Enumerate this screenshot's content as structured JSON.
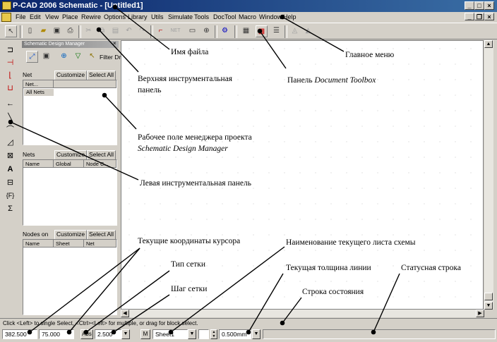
{
  "window": {
    "title": "P-CAD 2006 Schematic - [Untitled1]"
  },
  "menu": [
    "File",
    "Edit",
    "View",
    "Place",
    "Rewire",
    "Options",
    "Library",
    "Utils",
    "Simulate",
    "Tools",
    "DocTool",
    "Macro",
    "Window",
    "Help"
  ],
  "panel": {
    "title": "Schematic Design Manager",
    "filter_label": "Filter Dr",
    "net": {
      "label": "Net",
      "customize": "Customize",
      "select_all": "Select All",
      "col": "Net...",
      "item": "All Nets"
    },
    "nets": {
      "label": "Nets",
      "customize": "Customize",
      "select_all": "Select All",
      "cols": [
        "Name",
        "Global",
        "Node C..."
      ]
    },
    "nodes": {
      "label": "Nodes on",
      "customize": "Customize",
      "select_all": "Select All",
      "cols": [
        "Name",
        "Sheet",
        "Net"
      ]
    }
  },
  "help_line": "Click <Left> to single Select, <Ctrl><Left> for multiple, or drag for block select.",
  "status": {
    "x": "382.500",
    "y": "75.000",
    "grid_type": "Abs",
    "grid_step": "2.500",
    "m_label": "M",
    "sheet": "Sheet1",
    "line_width": "0.500mm"
  },
  "annotations": {
    "file_name": "Имя файла",
    "main_menu": "Главное меню",
    "top_toolbar_1": "Верхняя инструментальная",
    "top_toolbar_2": "панель",
    "doc_toolbox_prefix": "Панель",
    "doc_toolbox_name": "Document Toolbox",
    "sdm_1": "Рабочее поле менеджера проекта",
    "sdm_2": "Schematic Design Manager",
    "left_toolbar": "Левая инструментальная панель",
    "cursor_coords": "Текущие координаты курсора",
    "sheet_name": "Наименование текущего листа схемы",
    "grid_type": "Тип сетки",
    "line_width": "Текущая толщина линии",
    "status_line": "Статусная строка",
    "grid_step": "Шаг сетки",
    "state_line": "Строка состояния"
  }
}
